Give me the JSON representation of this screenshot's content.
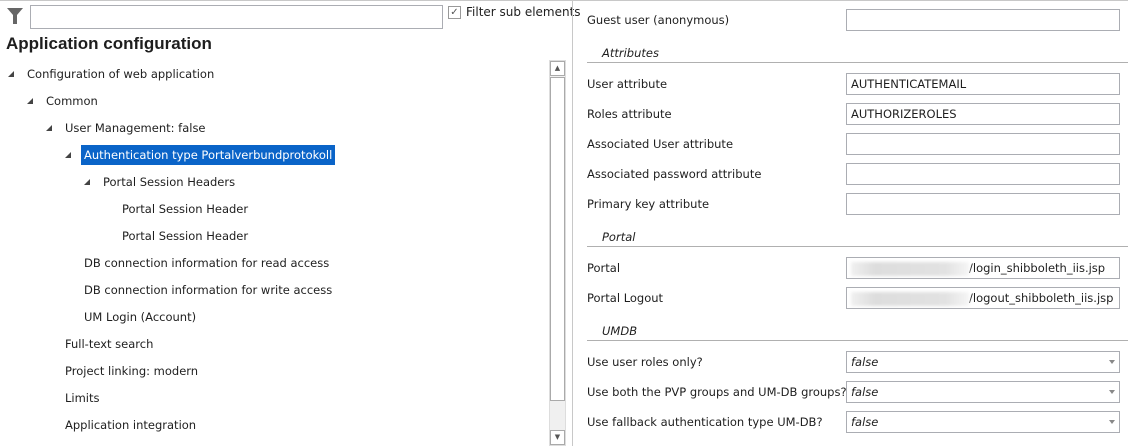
{
  "filter": {
    "placeholder": "",
    "value": "",
    "sub_elements_label": "Filter sub elements",
    "sub_elements_checked": true
  },
  "title": "Application configuration",
  "tree": [
    {
      "label": "Configuration of web application",
      "level": 0,
      "expanded": true
    },
    {
      "label": "Common",
      "level": 1,
      "expanded": true
    },
    {
      "label": "User Management: false",
      "level": 2,
      "expanded": true
    },
    {
      "label": "Authentication type Portalverbundprotokoll",
      "level": 3,
      "expanded": true,
      "selected": true
    },
    {
      "label": "Portal Session Headers",
      "level": 4,
      "expanded": true
    },
    {
      "label": "Portal Session Header",
      "level": 5
    },
    {
      "label": "Portal Session Header",
      "level": 5
    },
    {
      "label": "DB connection information for read access",
      "level": 3
    },
    {
      "label": "DB connection information for write access",
      "level": 3
    },
    {
      "label": "UM Login (Account)",
      "level": 3
    },
    {
      "label": "Full-text search",
      "level": 2
    },
    {
      "label": "Project linking: modern",
      "level": 2
    },
    {
      "label": "Limits",
      "level": 2
    },
    {
      "label": "Application integration",
      "level": 2
    }
  ],
  "props": {
    "guest": {
      "label": "Guest user (anonymous)",
      "value": ""
    },
    "attributes_section": "Attributes",
    "user_attr": {
      "label": "User attribute",
      "value": "AUTHENTICATEMAIL"
    },
    "roles_attr": {
      "label": "Roles attribute",
      "value": "AUTHORIZEROLES"
    },
    "assoc_user_attr": {
      "label": "Associated User attribute",
      "value": ""
    },
    "assoc_pwd_attr": {
      "label": "Associated password attribute",
      "value": ""
    },
    "pk_attr": {
      "label": "Primary key attribute",
      "value": ""
    },
    "portal_section": "Portal",
    "portal": {
      "label": "Portal",
      "value": "/login_shibboleth_iis.jsp"
    },
    "portal_logout": {
      "label": "Portal Logout",
      "value": "/logout_shibboleth_iis.jsp"
    },
    "umdb_section": "UMDB",
    "roles_only": {
      "label": "Use user roles only?",
      "value": "false"
    },
    "both_groups": {
      "label": "Use both the PVP groups and UM-DB groups?",
      "value": "false"
    },
    "fallback": {
      "label": "Use fallback authentication type UM-DB?",
      "value": "false"
    }
  }
}
